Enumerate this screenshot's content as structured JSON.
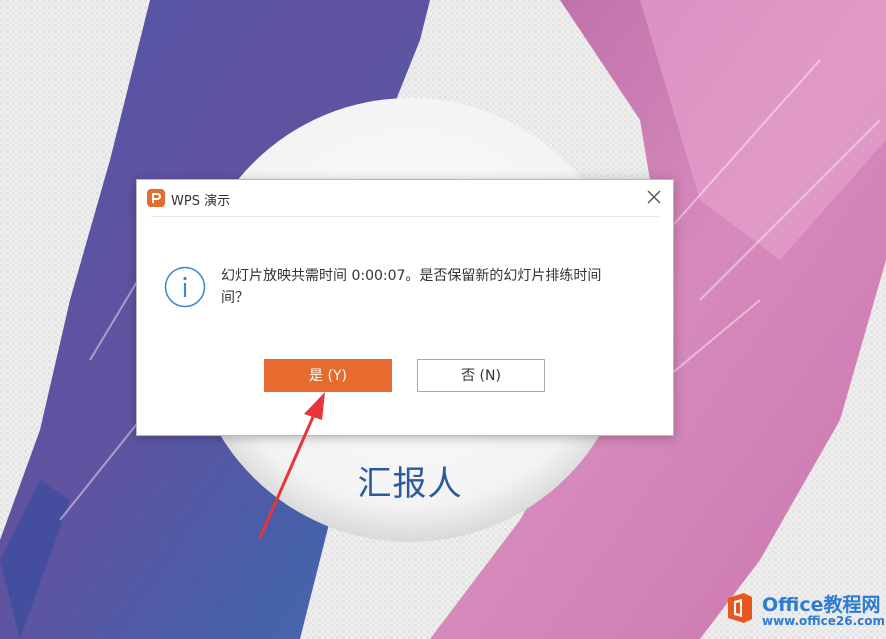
{
  "dialog": {
    "title": "WPS 演示",
    "app_icon_letter": "P",
    "message": "幻灯片放映共需时间 0:00:07。是否保留新的幻灯片排练时间？",
    "message_line1": "幻灯片放映共需时间 0:00:07。是否保留新的幻灯片排练时间",
    "message_line2": "间？",
    "yes_label": "是 (Y)",
    "no_label": "否 (N)"
  },
  "slide": {
    "reporter_label": "汇报人"
  },
  "watermark": {
    "title": "Office教程网",
    "url": "www.office26.com"
  },
  "colors": {
    "accent": "#e66b2c",
    "slide_text": "#2c5b9c",
    "watermark": "#2b7cd3",
    "arrow": "#e8343b"
  }
}
